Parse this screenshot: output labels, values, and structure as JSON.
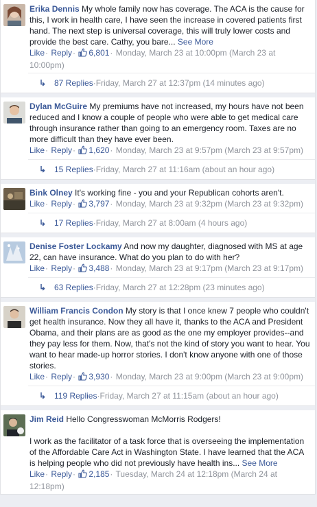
{
  "labels": {
    "like": "Like",
    "reply": "Reply",
    "see_more": "See More",
    "dot": "·"
  },
  "comments": [
    {
      "author": "Erika Dennis",
      "text": "My whole family now has coverage. The ACA is the cause for this, I work in health care, I have seen the increase in covered patients first hand. The next step is universal coverage, this will truly lower costs and provide the best care. Cathy, you bare...",
      "see_more": true,
      "likes": "6,801",
      "time": "Monday, March 23 at 10:00pm (March 23 at 10:00pm)",
      "replies": "87 Replies",
      "reply_time": "Friday, March 27 at 12:37pm (14 minutes ago)"
    },
    {
      "author": "Dylan McGuire",
      "text": "My premiums have not increased, my hours have not been reduced and I know a couple of people who were able to get medical care through insurance rather than going to an emergency room. Taxes are no more difficult than they have ever been.",
      "see_more": false,
      "likes": "1,620",
      "time": "Monday, March 23 at 9:57pm (March 23 at 9:57pm)",
      "replies": "15 Replies",
      "reply_time": "Friday, March 27 at 11:16am (about an hour ago)"
    },
    {
      "author": "Bink Olney",
      "text": "It's working fine - you and your Republican cohorts aren't.",
      "see_more": false,
      "likes": "3,797",
      "time": "Monday, March 23 at 9:32pm (March 23 at 9:32pm)",
      "replies": "17 Replies",
      "reply_time": "Friday, March 27 at 8:00am (4 hours ago)"
    },
    {
      "author": "Denise Foster Lockamy",
      "text": "And now my daughter, diagnosed with MS at age 22, can have insurance. What do you plan to do with her?",
      "see_more": false,
      "likes": "3,488",
      "time": "Monday, March 23 at 9:17pm (March 23 at 9:17pm)",
      "replies": "63 Replies",
      "reply_time": "Friday, March 27 at 12:28pm (23 minutes ago)"
    },
    {
      "author": "William Francis Condon",
      "text": "My story is that I once knew 7 people who couldn't get health insurance. Now they all have it, thanks to the ACA and President Obama, and their plans are as good as the one my employer provides--and they pay less for them. Now, that's not the kind of story you want to hear. You want to hear made-up horror stories. I don't know anyone with one of those stories.",
      "see_more": false,
      "likes": "3,930",
      "time": "Monday, March 23 at 9:00pm (March 23 at 9:00pm)",
      "replies": "119 Replies",
      "reply_time": "Friday, March 27 at 11:15am (about an hour ago)"
    },
    {
      "author": "Jim Reid",
      "text": "Hello Congresswoman McMorris Rodgers!",
      "text2": "I work as the facilitator of a task force that is overseeing the implementation of the Affordable Care Act in Washington State. I have learned that the ACA is helping people who did not previously have health ins...",
      "see_more": true,
      "likes": "2,185",
      "time": "Tuesday, March 24 at 12:18pm (March 24 at 12:18pm)"
    }
  ]
}
